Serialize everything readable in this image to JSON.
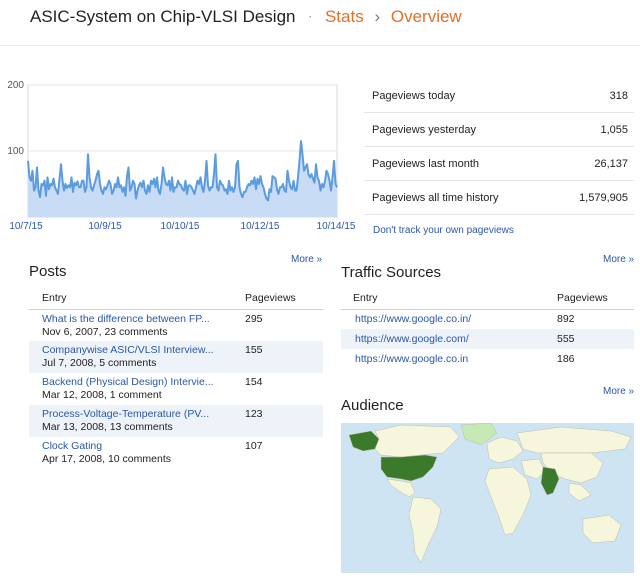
{
  "breadcrumb": {
    "blog": "ASIC-System on Chip-VLSI Design",
    "separator": "·",
    "stats": "Stats",
    "arrow": "›",
    "overview": "Overview"
  },
  "chart_data": {
    "type": "area",
    "y_ticks": [
      "200",
      "100"
    ],
    "ylim": [
      0,
      200
    ],
    "x_tick_labels": [
      "10/7/15",
      "10/9/15",
      "10/10/15",
      "10/12/15",
      "10/14/15"
    ],
    "fill_color": "#c8ddf5",
    "line_color": "#5b9bde",
    "values": [
      85,
      60,
      55,
      70,
      40,
      45,
      75,
      40,
      30,
      50,
      48,
      55,
      32,
      60,
      42,
      50,
      48,
      58,
      45,
      40,
      35,
      58,
      80,
      55,
      40,
      50,
      44,
      48,
      45,
      60,
      38,
      52,
      48,
      54,
      45,
      45,
      55,
      55,
      38,
      45,
      95,
      60,
      45,
      40,
      48,
      55,
      65,
      70,
      50,
      40,
      35,
      45,
      42,
      48,
      55,
      50,
      35,
      40,
      50,
      45,
      60,
      45,
      48,
      38,
      45,
      32,
      62,
      75,
      40,
      45,
      55,
      50,
      28,
      40,
      48,
      52,
      45,
      55,
      40,
      35,
      48,
      38,
      55,
      50,
      58,
      45,
      60,
      40,
      35,
      50,
      75,
      60,
      50,
      48,
      55,
      40,
      60,
      38,
      45,
      45,
      55,
      50,
      48,
      42,
      40,
      55,
      35,
      48,
      48,
      45,
      40,
      35,
      45,
      55,
      50,
      60,
      45,
      38,
      55,
      85,
      48,
      40,
      45,
      45,
      65,
      95,
      45,
      40,
      55,
      50,
      48,
      40,
      42,
      35,
      55,
      40,
      45,
      38,
      45,
      80,
      85,
      45,
      35,
      30,
      38,
      38,
      45,
      50,
      48,
      55,
      50,
      60,
      42,
      58,
      50,
      62,
      50,
      45,
      35,
      28,
      25,
      42,
      38,
      62,
      60,
      58,
      42,
      35,
      45,
      45,
      50,
      40,
      38,
      70,
      55,
      45,
      42,
      55,
      40,
      40,
      60,
      85,
      115,
      95,
      70,
      75,
      80,
      65,
      60,
      65,
      58,
      52,
      80,
      60,
      55,
      40,
      50,
      45,
      55,
      70,
      65,
      55,
      40,
      60,
      85,
      50,
      45
    ]
  },
  "stats": [
    {
      "label": "Pageviews today",
      "value": "318"
    },
    {
      "label": "Pageviews yesterday",
      "value": "1,055"
    },
    {
      "label": "Pageviews last month",
      "value": "26,137"
    },
    {
      "label": "Pageviews all time history",
      "value": "1,579,905"
    }
  ],
  "dont_track": "Don't track your own pageviews",
  "more_label": "More »",
  "posts": {
    "title": "Posts",
    "col_entry": "Entry",
    "col_pageviews": "Pageviews",
    "rows": [
      {
        "title": "What is the difference between FP...",
        "meta": "Nov 6, 2007, 23 comments",
        "pageviews": "295"
      },
      {
        "title": "Companywise ASIC/VLSI Interview...",
        "meta": "Jul 7, 2008, 5 comments",
        "pageviews": "155"
      },
      {
        "title": "Backend (Physical Design) Intervie...",
        "meta": "Mar 12, 2008, 1 comment",
        "pageviews": "154"
      },
      {
        "title": "Process-Voltage-Temperature (PV...",
        "meta": "Mar 13, 2008, 13 comments",
        "pageviews": "123"
      },
      {
        "title": "Clock Gating",
        "meta": "Apr 17, 2008, 10 comments",
        "pageviews": "107"
      }
    ]
  },
  "traffic": {
    "title": "Traffic Sources",
    "col_entry": "Entry",
    "col_pageviews": "Pageviews",
    "rows": [
      {
        "source": "https://www.google.co.in/",
        "pageviews": "892"
      },
      {
        "source": "https://www.google.com/",
        "pageviews": "555"
      },
      {
        "source": "https://www.google.co.in",
        "pageviews": "186"
      }
    ]
  },
  "audience": {
    "title": "Audience",
    "colors": {
      "ocean": "#cfe4f3",
      "land": "#f6f6dc",
      "low": "#c7e9b4",
      "high": "#3b7a2a",
      "border": "#bcbca8"
    }
  }
}
